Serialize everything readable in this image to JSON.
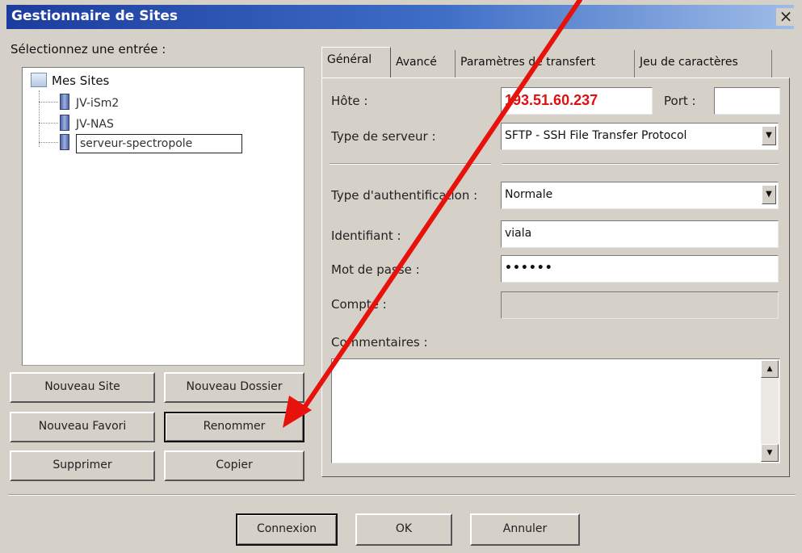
{
  "window": {
    "title": "Gestionnaire de Sites",
    "close_label": "×"
  },
  "left": {
    "select_label": "Sélectionnez une entrée :",
    "tree": {
      "root": "Mes Sites",
      "items": [
        {
          "label": "JV-iSm2"
        },
        {
          "label": "JV-NAS"
        },
        {
          "label": "serveur-spectropole",
          "editing": true
        }
      ]
    },
    "buttons": {
      "new_site": "Nouveau Site",
      "new_folder": "Nouveau Dossier",
      "new_bookmark": "Nouveau Favori",
      "rename": "Renommer",
      "delete": "Supprimer",
      "copy": "Copier"
    }
  },
  "tabs": [
    {
      "label": "Général",
      "active": true
    },
    {
      "label": "Avancé"
    },
    {
      "label": "Paramètres de transfert"
    },
    {
      "label": "Jeu de caractères"
    }
  ],
  "general": {
    "host_label": "Hôte :",
    "host_value": "193.51.60.237",
    "port_label": "Port :",
    "port_value": "",
    "server_type_label": "Type de serveur :",
    "server_type_value": "SFTP - SSH File Transfer Protocol",
    "auth_type_label": "Type d'authentification :",
    "auth_type_value": "Normale",
    "username_label": "Identifiant :",
    "username_value": "viala",
    "password_label": "Mot de passe :",
    "password_value": "••••••",
    "account_label": "Compte :",
    "account_value": "",
    "comments_label": "Commentaires :",
    "comments_value": ""
  },
  "footer": {
    "connect": "Connexion",
    "ok": "OK",
    "cancel": "Annuler"
  },
  "colors": {
    "annotation_arrow": "#e8120c",
    "host_text": "#dd1111",
    "title_bar": "#1c3c9e"
  },
  "icons": {
    "scroll_up": "▲",
    "scroll_down": "▼",
    "dropdown": "▼"
  }
}
